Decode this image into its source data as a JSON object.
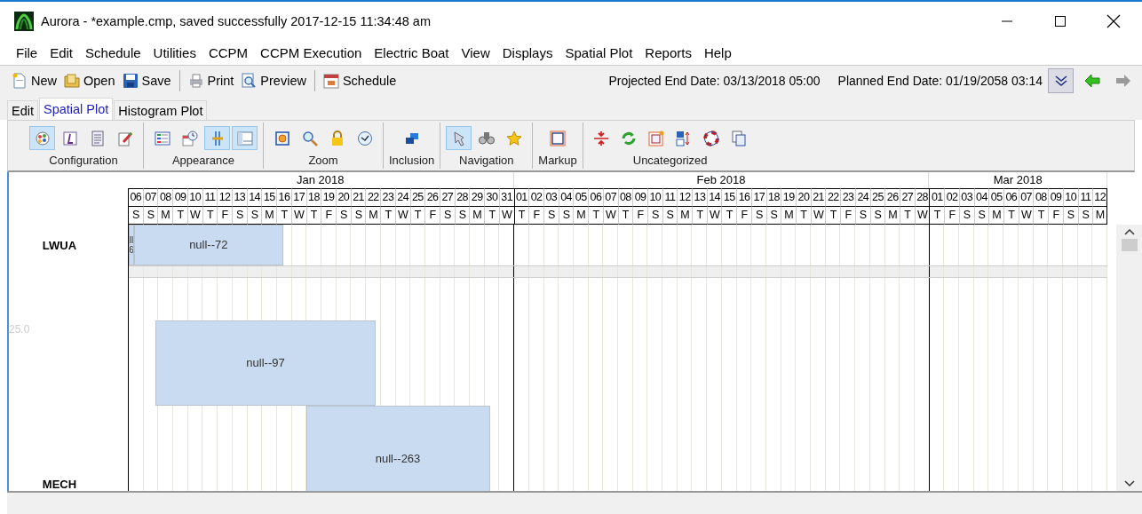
{
  "window": {
    "title": "Aurora - *example.cmp, saved successfully 2017-12-15 11:34:48 am"
  },
  "menu": [
    "File",
    "Edit",
    "Schedule",
    "Utilities",
    "CCPM",
    "CCPM Execution",
    "Electric Boat",
    "View",
    "Displays",
    "Spatial Plot",
    "Reports",
    "Help"
  ],
  "toolbar": {
    "groups": [
      [
        {
          "label": "New"
        },
        {
          "label": "Open"
        },
        {
          "label": "Save"
        }
      ],
      [
        {
          "label": "Print"
        },
        {
          "label": "Preview"
        }
      ],
      [
        {
          "label": "Schedule"
        }
      ]
    ],
    "projected_end": "Projected End Date: 03/13/2018 05:00",
    "planned_end": "Planned End Date: 01/19/2058 03:14",
    "nav": [
      {
        "kind": "expand",
        "selected": true,
        "disabled": false
      },
      {
        "kind": "back",
        "selected": false,
        "disabled": false
      },
      {
        "kind": "forward",
        "selected": false,
        "disabled": true
      }
    ]
  },
  "tabs": [
    {
      "label": "Edit",
      "selected": false
    },
    {
      "label": "Spatial Plot",
      "selected": true
    },
    {
      "label": "Histogram Plot",
      "selected": false
    }
  ],
  "ribbon": [
    {
      "label": "Configuration",
      "buttons": [
        {
          "selected": true
        },
        {
          "selected": false
        },
        {
          "selected": false
        },
        {
          "selected": false
        }
      ]
    },
    {
      "label": "Appearance",
      "buttons": [
        {
          "selected": false
        },
        {
          "selected": false
        },
        {
          "selected": true
        },
        {
          "selected": true
        }
      ]
    },
    {
      "label": "Zoom",
      "buttons": [
        {
          "selected": false
        },
        {
          "selected": false
        },
        {
          "selected": false
        },
        {
          "selected": false
        }
      ]
    },
    {
      "label": "Inclusion",
      "buttons": [
        {
          "selected": false
        }
      ]
    },
    {
      "label": "Navigation",
      "buttons": [
        {
          "selected": true
        },
        {
          "selected": false
        },
        {
          "selected": false
        }
      ]
    },
    {
      "label": "Markup",
      "buttons": [
        {
          "selected": false
        }
      ]
    },
    {
      "label": "Uncategorized",
      "buttons": [
        {
          "selected": false
        },
        {
          "selected": false
        },
        {
          "selected": false
        },
        {
          "selected": false
        },
        {
          "selected": false
        },
        {
          "selected": false
        }
      ]
    }
  ],
  "plot": {
    "months": [
      {
        "label": "Jan 2018",
        "dates": [
          "06",
          "07",
          "08",
          "09",
          "10",
          "11",
          "12",
          "13",
          "14",
          "15",
          "16",
          "17",
          "18",
          "19",
          "20",
          "21",
          "22",
          "23",
          "24",
          "25",
          "26",
          "27",
          "28",
          "29",
          "30",
          "31"
        ],
        "weekdays": [
          "S",
          "S",
          "M",
          "T",
          "W",
          "T",
          "F",
          "S",
          "S",
          "M",
          "T",
          "W",
          "T",
          "F",
          "S",
          "S",
          "M",
          "T",
          "W",
          "T",
          "F",
          "S",
          "S",
          "M",
          "T",
          "W"
        ]
      },
      {
        "label": "Feb 2018",
        "dates": [
          "01",
          "02",
          "03",
          "04",
          "05",
          "06",
          "07",
          "08",
          "09",
          "10",
          "11",
          "12",
          "13",
          "14",
          "15",
          "16",
          "17",
          "18",
          "19",
          "20",
          "21",
          "22",
          "23",
          "24",
          "25",
          "26",
          "27",
          "28"
        ],
        "weekdays": [
          "T",
          "F",
          "S",
          "S",
          "M",
          "T",
          "W",
          "T",
          "F",
          "S",
          "S",
          "M",
          "T",
          "W",
          "T",
          "F",
          "S",
          "S",
          "M",
          "T",
          "W",
          "T",
          "F",
          "S",
          "S",
          "M",
          "T",
          "W"
        ]
      },
      {
        "label": "Mar 2018",
        "dates": [
          "01",
          "02",
          "03",
          "04",
          "05",
          "06",
          "07",
          "08",
          "09",
          "10",
          "11",
          "12"
        ],
        "weekdays": [
          "T",
          "F",
          "S",
          "S",
          "M",
          "T",
          "W",
          "T",
          "F",
          "S",
          "S",
          "M"
        ]
      }
    ],
    "rows": [
      {
        "label": "LWUA",
        "bars": [
          {
            "lines": [
              "ll",
              "6"
            ]
          },
          {
            "lines": [
              "null--72"
            ]
          }
        ]
      },
      {
        "label": "MECH",
        "axis_label": "25.0",
        "bars": [
          {
            "lines": [
              "null--97"
            ]
          },
          {
            "lines": [
              "null--263"
            ]
          }
        ]
      }
    ]
  }
}
